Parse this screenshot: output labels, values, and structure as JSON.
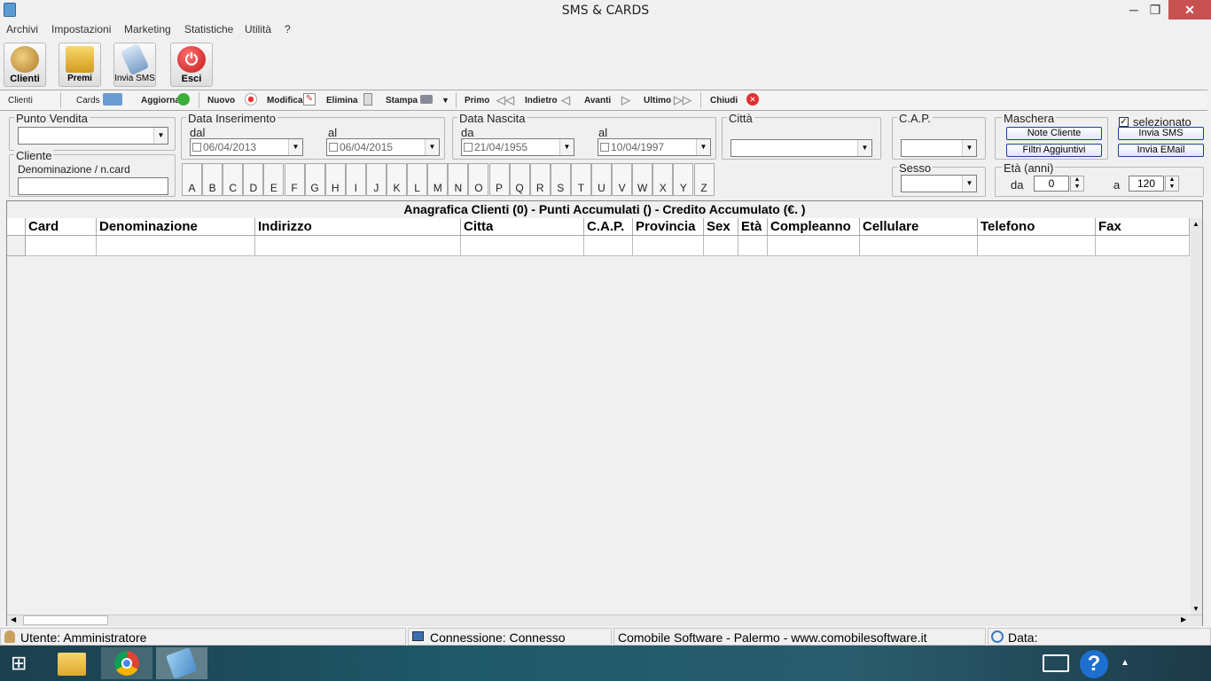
{
  "window": {
    "title": "SMS & CARDS",
    "minimize": "─",
    "restore": "❐",
    "close": "✕"
  },
  "menu": [
    "Archivi",
    "Impostazioni",
    "Marketing",
    "Statistiche",
    "Utilità",
    "?"
  ],
  "toolbar_big": [
    {
      "label": "Clienti",
      "icon": "users-icon",
      "color": "#c79a3a"
    },
    {
      "label": "Premi",
      "icon": "gift-box-icon",
      "color": "#e6b63a"
    },
    {
      "label": "Invia SMS",
      "icon": "phone-sms-icon",
      "color": "#8aaecf"
    },
    {
      "label": "Esci",
      "icon": "power-icon",
      "color": "#d23030"
    }
  ],
  "toolbar_small": {
    "clienti": "Clienti",
    "cards": "Cards",
    "aggiorna": "Aggiorna",
    "nuovo": "Nuovo",
    "modifica": "Modifica",
    "elimina": "Elimina",
    "stampa": "Stampa",
    "primo": "Primo",
    "indietro": "Indietro",
    "avanti": "Avanti",
    "ultimo": "Ultimo",
    "chiudi": "Chiudi"
  },
  "filters": {
    "punto_vendita": {
      "label": "Punto Vendita",
      "value": ""
    },
    "cliente": {
      "label": "Cliente",
      "sublabel": "Denominazione / n.card",
      "value": ""
    },
    "data_inserimento": {
      "label": "Data Inserimento",
      "dal_label": "dal",
      "dal": "06/04/2013",
      "al_label": "al",
      "al": "06/04/2015"
    },
    "data_nascita": {
      "label": "Data Nascita",
      "da_label": "da",
      "da": "21/04/1955",
      "al_label": "al",
      "al": "10/04/1997"
    },
    "citta": {
      "label": "Città",
      "value": ""
    },
    "cap": {
      "label": "C.A.P.",
      "value": ""
    },
    "sesso": {
      "label": "Sesso",
      "value": ""
    },
    "maschera": {
      "label": "Maschera",
      "note_cliente": "Note Cliente",
      "filtri": "Filtri Aggiuntivi"
    },
    "selezionato": {
      "label": "selezionato",
      "checked": true
    },
    "invia_sms": "Invia SMS",
    "invia_email": "Invia EMail",
    "eta": {
      "label": "Età (anni)",
      "da_label": "da",
      "da": "0",
      "a_label": "a",
      "a": "120"
    }
  },
  "letters": [
    "A",
    "B",
    "C",
    "D",
    "E",
    "F",
    "G",
    "H",
    "I",
    "J",
    "K",
    "L",
    "M",
    "N",
    "O",
    "P",
    "Q",
    "R",
    "S",
    "T",
    "U",
    "V",
    "W",
    "X",
    "Y",
    "Z"
  ],
  "grid": {
    "title": "Anagrafica Clienti (0)  - Punti Accumulati () - Credito Accumulato (€. )",
    "columns": [
      "Card",
      "Denominazione",
      "Indirizzo",
      "Citta",
      "C.A.P.",
      "Provincia",
      "Sex",
      "Età",
      "Compleanno",
      "Cellulare",
      "Telefono",
      "Fax"
    ]
  },
  "status": {
    "utente": "Utente: Amministratore",
    "connessione": "Connessione: Connesso",
    "company": "Comobile Software - Palermo - www.comobilesoftware.it",
    "data": "Data:"
  },
  "taskbar": {
    "apps": [
      "start-icon",
      "file-explorer-icon",
      "chrome-icon",
      "sms-cards-icon"
    ],
    "tray": [
      "keyboard-icon",
      "help-icon",
      "tray-arrow-icon"
    ]
  }
}
